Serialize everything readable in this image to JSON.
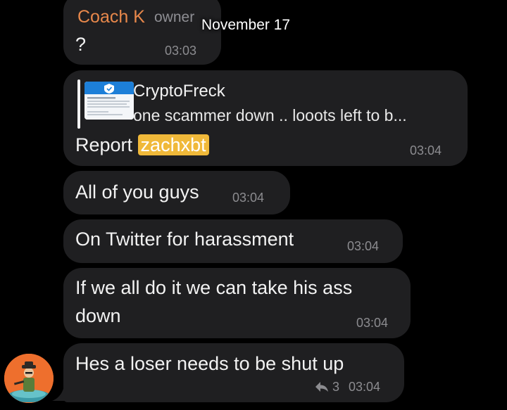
{
  "date_header": "November 17",
  "messages": [
    {
      "sender": "Coach K",
      "role": "owner",
      "text": "?",
      "time": "03:03"
    },
    {
      "quote": {
        "author": "CryptoFreck",
        "preview": "one scammer down .. looots left to b..."
      },
      "text_before": "Report ",
      "mention": "zachxbt",
      "time": "03:04"
    },
    {
      "text": "All of you guys",
      "time": "03:04"
    },
    {
      "text": "On Twitter for harassment",
      "time": "03:04"
    },
    {
      "lines": [
        "If we all do it we can take his ass",
        "down"
      ],
      "time": "03:04"
    },
    {
      "text": "Hes a loser needs to be shut up",
      "reply_count": "3",
      "time": "03:04"
    }
  ],
  "colors": {
    "background": "#000000",
    "bubble": "#1f1f21",
    "sender_name": "#e8884b",
    "mention_highlight": "#f0b93a",
    "timestamp": "#8c8c90",
    "avatar": "#ee6f2d"
  },
  "icons": {
    "reply": "reply-arrow-icon",
    "avatar": "user-avatar",
    "quote_thumbnail": "tweet-preview-thumbnail"
  }
}
